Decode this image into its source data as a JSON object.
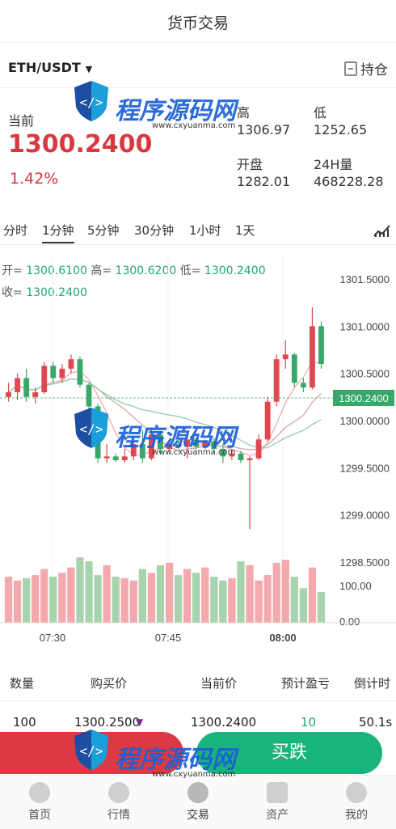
{
  "header": {
    "title": "货币交易"
  },
  "pair": {
    "symbol": "ETH/USDT",
    "hold_label": "持仓"
  },
  "price": {
    "label": "当前",
    "value": "1300.2400",
    "change": "1.42%"
  },
  "stats": {
    "high_label": "高",
    "high": "1306.97",
    "low_label": "低",
    "low": "1252.65",
    "open_label": "开盘",
    "open": "1282.01",
    "vol_label": "24H量",
    "vol": "468228.28"
  },
  "timeframes": [
    "分时",
    "1分钟",
    "5分钟",
    "30分钟",
    "1小时",
    "1天"
  ],
  "active_timeframe": "1分钟",
  "kline_info": {
    "open_label": "开=",
    "open": "1300.6100",
    "high_label": "高=",
    "high": "1300.6200",
    "low_label": "低=",
    "low": "1300.2400",
    "close_label": "收=",
    "close": "1300.2400"
  },
  "chart_data": {
    "type": "candlestick",
    "yticks": [
      "1301.5000",
      "1301.0000",
      "1300.5000",
      "1300.0000",
      "1299.5000",
      "1299.0000",
      "1298.5000"
    ],
    "ylim": [
      1298.5,
      1301.5
    ],
    "current_price": "1300.2400",
    "volume_ticks": [
      "100.00",
      "0.00"
    ],
    "xticks": [
      "07:30",
      "07:45",
      "08:00"
    ],
    "candles": [
      {
        "o": 1300.25,
        "h": 1300.4,
        "l": 1300.2,
        "c": 1300.3
      },
      {
        "o": 1300.3,
        "h": 1300.5,
        "l": 1300.22,
        "c": 1300.45
      },
      {
        "o": 1300.45,
        "h": 1300.55,
        "l": 1300.2,
        "c": 1300.25
      },
      {
        "o": 1300.25,
        "h": 1300.35,
        "l": 1300.18,
        "c": 1300.3
      },
      {
        "o": 1300.3,
        "h": 1300.62,
        "l": 1300.28,
        "c": 1300.58
      },
      {
        "o": 1300.58,
        "h": 1300.62,
        "l": 1300.4,
        "c": 1300.45
      },
      {
        "o": 1300.45,
        "h": 1300.6,
        "l": 1300.4,
        "c": 1300.55
      },
      {
        "o": 1300.55,
        "h": 1300.7,
        "l": 1300.5,
        "c": 1300.65
      },
      {
        "o": 1300.65,
        "h": 1300.68,
        "l": 1300.35,
        "c": 1300.38
      },
      {
        "o": 1300.38,
        "h": 1300.4,
        "l": 1300.1,
        "c": 1300.15
      },
      {
        "o": 1300.15,
        "h": 1300.18,
        "l": 1299.55,
        "c": 1299.6
      },
      {
        "o": 1299.6,
        "h": 1299.75,
        "l": 1299.55,
        "c": 1299.62
      },
      {
        "o": 1299.62,
        "h": 1299.65,
        "l": 1299.56,
        "c": 1299.58
      },
      {
        "o": 1299.58,
        "h": 1299.7,
        "l": 1299.55,
        "c": 1299.62
      },
      {
        "o": 1299.62,
        "h": 1299.8,
        "l": 1299.58,
        "c": 1299.75
      },
      {
        "o": 1299.75,
        "h": 1299.9,
        "l": 1299.55,
        "c": 1299.6
      },
      {
        "o": 1299.6,
        "h": 1299.9,
        "l": 1299.58,
        "c": 1299.85
      },
      {
        "o": 1299.85,
        "h": 1299.88,
        "l": 1299.65,
        "c": 1299.7
      },
      {
        "o": 1299.7,
        "h": 1299.78,
        "l": 1299.68,
        "c": 1299.75
      },
      {
        "o": 1299.75,
        "h": 1299.8,
        "l": 1299.7,
        "c": 1299.72
      },
      {
        "o": 1299.72,
        "h": 1299.85,
        "l": 1299.6,
        "c": 1299.8
      },
      {
        "o": 1299.8,
        "h": 1299.82,
        "l": 1299.7,
        "c": 1299.72
      },
      {
        "o": 1299.72,
        "h": 1299.8,
        "l": 1299.7,
        "c": 1299.78
      },
      {
        "o": 1299.78,
        "h": 1299.82,
        "l": 1299.65,
        "c": 1299.7
      },
      {
        "o": 1299.7,
        "h": 1299.75,
        "l": 1299.55,
        "c": 1299.62
      },
      {
        "o": 1299.62,
        "h": 1299.7,
        "l": 1299.58,
        "c": 1299.65
      },
      {
        "o": 1299.65,
        "h": 1299.68,
        "l": 1299.55,
        "c": 1299.58
      },
      {
        "o": 1299.58,
        "h": 1299.62,
        "l": 1298.85,
        "c": 1299.6
      },
      {
        "o": 1299.6,
        "h": 1299.85,
        "l": 1299.58,
        "c": 1299.8
      },
      {
        "o": 1299.8,
        "h": 1300.25,
        "l": 1299.78,
        "c": 1300.2
      },
      {
        "o": 1300.2,
        "h": 1300.7,
        "l": 1300.15,
        "c": 1300.65
      },
      {
        "o": 1300.65,
        "h": 1300.85,
        "l": 1300.55,
        "c": 1300.7
      },
      {
        "o": 1300.7,
        "h": 1300.72,
        "l": 1300.35,
        "c": 1300.4
      },
      {
        "o": 1300.4,
        "h": 1300.45,
        "l": 1300.3,
        "c": 1300.35
      },
      {
        "o": 1300.35,
        "h": 1301.2,
        "l": 1300.33,
        "c": 1301.0
      },
      {
        "o": 1301.0,
        "h": 1301.05,
        "l": 1300.55,
        "c": 1300.6
      }
    ],
    "volumes": [
      60,
      55,
      58,
      62,
      70,
      60,
      65,
      72,
      85,
      80,
      62,
      75,
      60,
      58,
      55,
      70,
      65,
      75,
      78,
      62,
      70,
      65,
      72,
      60,
      55,
      58,
      80,
      75,
      55,
      62,
      78,
      82,
      60,
      45,
      72,
      40
    ]
  },
  "trade_table": {
    "headers": [
      "数量",
      "购买价",
      "当前价",
      "预计盈亏",
      "倒计时"
    ],
    "rows": [
      [
        "100",
        "1300.2500",
        "1300.2400",
        "10",
        "50.1s"
      ]
    ]
  },
  "actions": {
    "buy_up": "",
    "buy_down": "买跌"
  },
  "tabbar": [
    "首页",
    "行情",
    "交易",
    "资产",
    "我的"
  ],
  "watermark": {
    "text": "程序源码网",
    "url": "www.cxyuanma.com"
  },
  "colors": {
    "up": "#e04850",
    "down": "#37a869",
    "accent": "#19b47b"
  }
}
